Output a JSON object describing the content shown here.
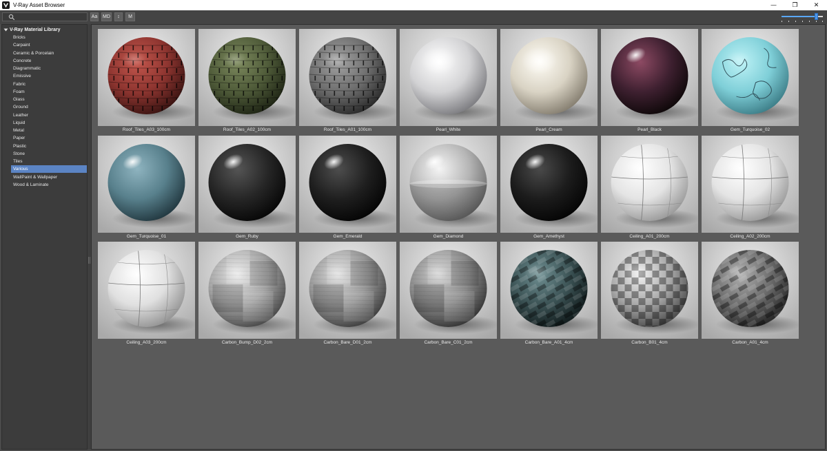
{
  "window": {
    "title": "V-Ray Asset Browser",
    "minimize_glyph": "—",
    "restore_glyph": "❐",
    "close_glyph": "✕"
  },
  "toolbar": {
    "search": {
      "value": "",
      "placeholder": ""
    },
    "buttons": [
      {
        "label": "Aa"
      },
      {
        "label": "MD"
      },
      {
        "label": "↕"
      },
      {
        "label": "M"
      }
    ],
    "thumbnail_size_fraction": 0.88
  },
  "sidebar": {
    "root_label": "V-Ray Material Library",
    "items": [
      {
        "label": "Bricks",
        "selected": false
      },
      {
        "label": "Carpaint",
        "selected": false
      },
      {
        "label": "Ceramic & Porcelain",
        "selected": false
      },
      {
        "label": "Concrete",
        "selected": false
      },
      {
        "label": "Diagrammatic",
        "selected": false
      },
      {
        "label": "Emissive",
        "selected": false
      },
      {
        "label": "Fabric",
        "selected": false
      },
      {
        "label": "Foam",
        "selected": false
      },
      {
        "label": "Glass",
        "selected": false
      },
      {
        "label": "Ground",
        "selected": false
      },
      {
        "label": "Leather",
        "selected": false
      },
      {
        "label": "Liquid",
        "selected": false
      },
      {
        "label": "Metal",
        "selected": false
      },
      {
        "label": "Paper",
        "selected": false
      },
      {
        "label": "Plastic",
        "selected": false
      },
      {
        "label": "Stone",
        "selected": false
      },
      {
        "label": "Tiles",
        "selected": false
      },
      {
        "label": "Various",
        "selected": true
      },
      {
        "label": "WallPaint & Wallpaper",
        "selected": false
      },
      {
        "label": "Wood & Laminate",
        "selected": false
      }
    ]
  },
  "materials": [
    {
      "name": "Roof_Tiles_A03_100cm",
      "look": "tiles",
      "light": "#c4574d",
      "base": "#8e3530",
      "dark": "#3a1412"
    },
    {
      "name": "Roof_Tiles_A02_100cm",
      "look": "tiles",
      "light": "#7d8a5e",
      "base": "#4f5b39",
      "dark": "#1f2515"
    },
    {
      "name": "Roof_Tiles_A01_100cm",
      "look": "tiles",
      "light": "#a3a3a3",
      "base": "#6e6e6e",
      "dark": "#2a2a2a"
    },
    {
      "name": "Pearl_White",
      "look": "pearl",
      "light": "#ffffff",
      "base": "#d2d2d4",
      "dark": "#7c7c80"
    },
    {
      "name": "Pearl_Cream",
      "look": "pearl",
      "light": "#fffdf6",
      "base": "#d9d3c4",
      "dark": "#857e70"
    },
    {
      "name": "Pearl_Black",
      "look": "glossy",
      "light": "#8d4a63",
      "base": "#3e2030",
      "dark": "#0e0809"
    },
    {
      "name": "Gem_Turquoise_02",
      "look": "turquoise",
      "light": "#bdf2f6",
      "base": "#7fcfd8",
      "dark": "#3d7e88"
    },
    {
      "name": "Gem_Turquoise_01",
      "look": "glossy",
      "light": "#8fb4c0",
      "base": "#58808c",
      "dark": "#223840"
    },
    {
      "name": "Gem_Ruby",
      "look": "glossy",
      "light": "#555555",
      "base": "#262626",
      "dark": "#070707"
    },
    {
      "name": "Gem_Emerald",
      "look": "glossy",
      "light": "#4e4e4e",
      "base": "#1f1f1f",
      "dark": "#050505"
    },
    {
      "name": "Gem_Diamond",
      "look": "glass",
      "light": "#f5f5f5",
      "base": "#b5b5b5",
      "dark": "#6a6a6a"
    },
    {
      "name": "Gem_Amethyst",
      "look": "glossy",
      "light": "#4a4a4a",
      "base": "#1c1c1c",
      "dark": "#050505"
    },
    {
      "name": "Ceiling_A01_200cm",
      "look": "ceiling",
      "light": "#ffffff",
      "base": "#e4e4e4",
      "dark": "#9a9a9a"
    },
    {
      "name": "Ceiling_A02_200cm",
      "look": "ceiling",
      "light": "#ffffff",
      "base": "#e4e4e4",
      "dark": "#9a9a9a"
    },
    {
      "name": "Ceiling_A03_200cm",
      "look": "ceiling",
      "light": "#ffffff",
      "base": "#e0e0e0",
      "dark": "#949494"
    },
    {
      "name": "Carbon_Bump_D02_2cm",
      "look": "metal",
      "light": "#e6e6e6",
      "base": "#a4a4a4",
      "dark": "#4a4a4a"
    },
    {
      "name": "Carbon_Bare_D01_2cm",
      "look": "metal",
      "light": "#dcdcdc",
      "base": "#979797",
      "dark": "#404040"
    },
    {
      "name": "Carbon_Bare_C01_2cm",
      "look": "metal",
      "light": "#cfcfcf",
      "base": "#8a8a8a",
      "dark": "#353535"
    },
    {
      "name": "Carbon_Bare_A01_4cm",
      "look": "carbon",
      "light": "#6f8f92",
      "base": "#3b5254",
      "dark": "#111b1c"
    },
    {
      "name": "Carbon_B01_4cm",
      "look": "check",
      "light": "#f0f0f0",
      "base": "#a8a8a8",
      "dark": "#4a4a4a"
    },
    {
      "name": "Carbon_A01_4cm",
      "look": "carbon",
      "light": "#b0b0b0",
      "base": "#6c6c6c",
      "dark": "#262626"
    }
  ]
}
